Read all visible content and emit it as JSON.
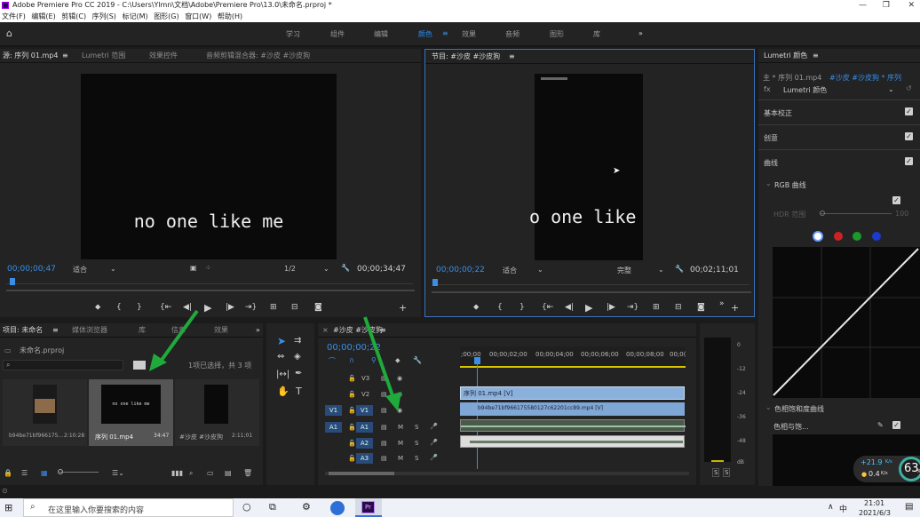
{
  "window": {
    "title": "Adobe Premiere Pro CC 2019 - C:\\Users\\Ylmn\\文档\\Adobe\\Premiere Pro\\13.0\\未命名.prproj *"
  },
  "menu": [
    "文件(F)",
    "编辑(E)",
    "剪辑(C)",
    "序列(S)",
    "标记(M)",
    "图形(G)",
    "窗口(W)",
    "帮助(H)"
  ],
  "workspaces": {
    "tabs": [
      "学习",
      "组件",
      "编辑",
      "颜色",
      "效果",
      "音频",
      "图形",
      "库"
    ],
    "active": "颜色",
    "more": "»"
  },
  "source_panel": {
    "tabs": [
      "源: 序列 01.mp4",
      "Lumetri 范围",
      "效果控件",
      "音频剪辑混合器: #沙皮 #沙皮狗"
    ],
    "caption": "no one like me",
    "timecode_left": "00;00;00;47",
    "fit": "适合",
    "resolution": "1/2",
    "timecode_right": "00;00;34;47"
  },
  "program_panel": {
    "tab": "节目: #沙皮 #沙皮狗",
    "caption": "o one like",
    "timecode_left": "00;00;00;22",
    "fit": "适合",
    "quality": "完整",
    "timecode_right": "00;02;11;01"
  },
  "project_panel": {
    "tabs": [
      "项目: 未命名",
      "媒体浏览器",
      "库",
      "信息",
      "效果"
    ],
    "file": "未命名.prproj",
    "selection_info": "1项已选择，共 3 项",
    "items": [
      {
        "name": "b94be71bf966175...",
        "duration": "2:10:28"
      },
      {
        "name": "序列 01.mp4",
        "duration": "34:47",
        "preview": "no one like me"
      },
      {
        "name": "#沙皮 #沙皮狗",
        "duration": "2:11;01"
      }
    ]
  },
  "timeline": {
    "tab": "#沙皮 #沙皮狗",
    "timecode": "00;00;00;22",
    "ruler": [
      ";00;00",
      "00;00;02;00",
      "00;00;04;00",
      "00;00;06;00",
      "00;00;08;00",
      "00;0("
    ],
    "video_tracks": [
      "V3",
      "V2",
      "V1"
    ],
    "audio_tracks": [
      "A1",
      "A2",
      "A3"
    ],
    "source_v": "V1",
    "source_a": "A1",
    "clips": {
      "v2": "序列 01.mp4 [V]",
      "v1": "b94be71bf966175580127c62201cc89.mp4 [V]"
    }
  },
  "meter": {
    "scale": [
      "0",
      "-12",
      "-24",
      "-36",
      "-48",
      "dB"
    ],
    "solo": [
      "S",
      "S"
    ]
  },
  "lumetri": {
    "tab": "Lumetri 颜色",
    "master": "主 * 序列 01.mp4",
    "sequence": "#沙皮 #沙皮狗 * 序列",
    "effect": "Lumetri 颜色",
    "sections": [
      "基本校正",
      "创意",
      "曲线"
    ],
    "rgb_curves": "RGB 曲线",
    "hdr_label": "HDR 范围",
    "hdr_value": "100",
    "hue_section": "色相饱和度曲线",
    "hue_sub": "色相与饱..."
  },
  "network": {
    "up": "+21.9",
    "up_unit": "K/s",
    "down": "0.4",
    "down_unit": "K/s",
    "cpu": "63",
    "cpu_unit": "%"
  },
  "taskbar": {
    "search_placeholder": "在这里输入你要搜索的内容",
    "time": "21:01",
    "date": "2021/6/3",
    "lang": "中"
  },
  "colors": {
    "accent": "#2d8ceb",
    "arrow": "#1faa3b",
    "clip_blue": "#8ab0dc",
    "clip_audio": "#9fc4a5"
  }
}
